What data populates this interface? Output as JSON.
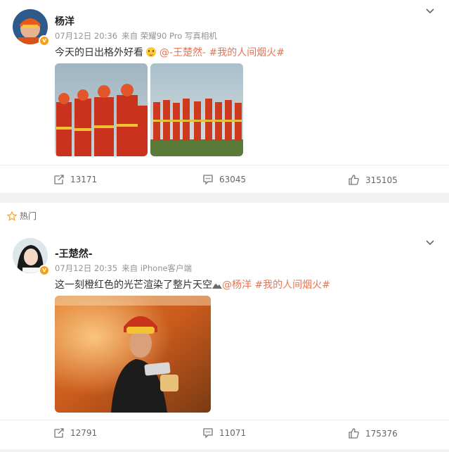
{
  "posts": [
    {
      "username": "杨洋",
      "date": "07月12日 20:36",
      "source": "来自 荣耀90 Pro 写真相机",
      "text": "今天的日出格外好看",
      "mention": "@-王楚然-",
      "hashtag": "#我的人间烟火#",
      "actions": {
        "reposts": "13171",
        "comments": "63045",
        "likes": "315105"
      },
      "images": [
        "sunrise-firefighters-photo-1",
        "sunrise-firefighters-photo-2"
      ]
    },
    {
      "hot_label": "热门",
      "username": "-王楚然-",
      "date": "07月12日 20:35",
      "source": "来自 iPhone客户端",
      "text": "这一刻橙红色的光芒渲染了整片天空",
      "mention": "@杨洋",
      "hashtag": "#我的人间烟火#",
      "actions": {
        "reposts": "12791",
        "comments": "11071",
        "likes": "175376"
      },
      "images": [
        "firefighter-holding-phone-photo"
      ]
    }
  ],
  "icons": {
    "verified": "verified-badge-icon",
    "menu": "chevron-down-icon",
    "repost": "repost-icon",
    "comment": "comment-icon",
    "like": "thumbs-up-icon",
    "hot": "star-icon"
  },
  "colors": {
    "link": "#eb7350",
    "badge": "#f7a11a",
    "meta": "#939393",
    "background": "#f2f2f2"
  }
}
